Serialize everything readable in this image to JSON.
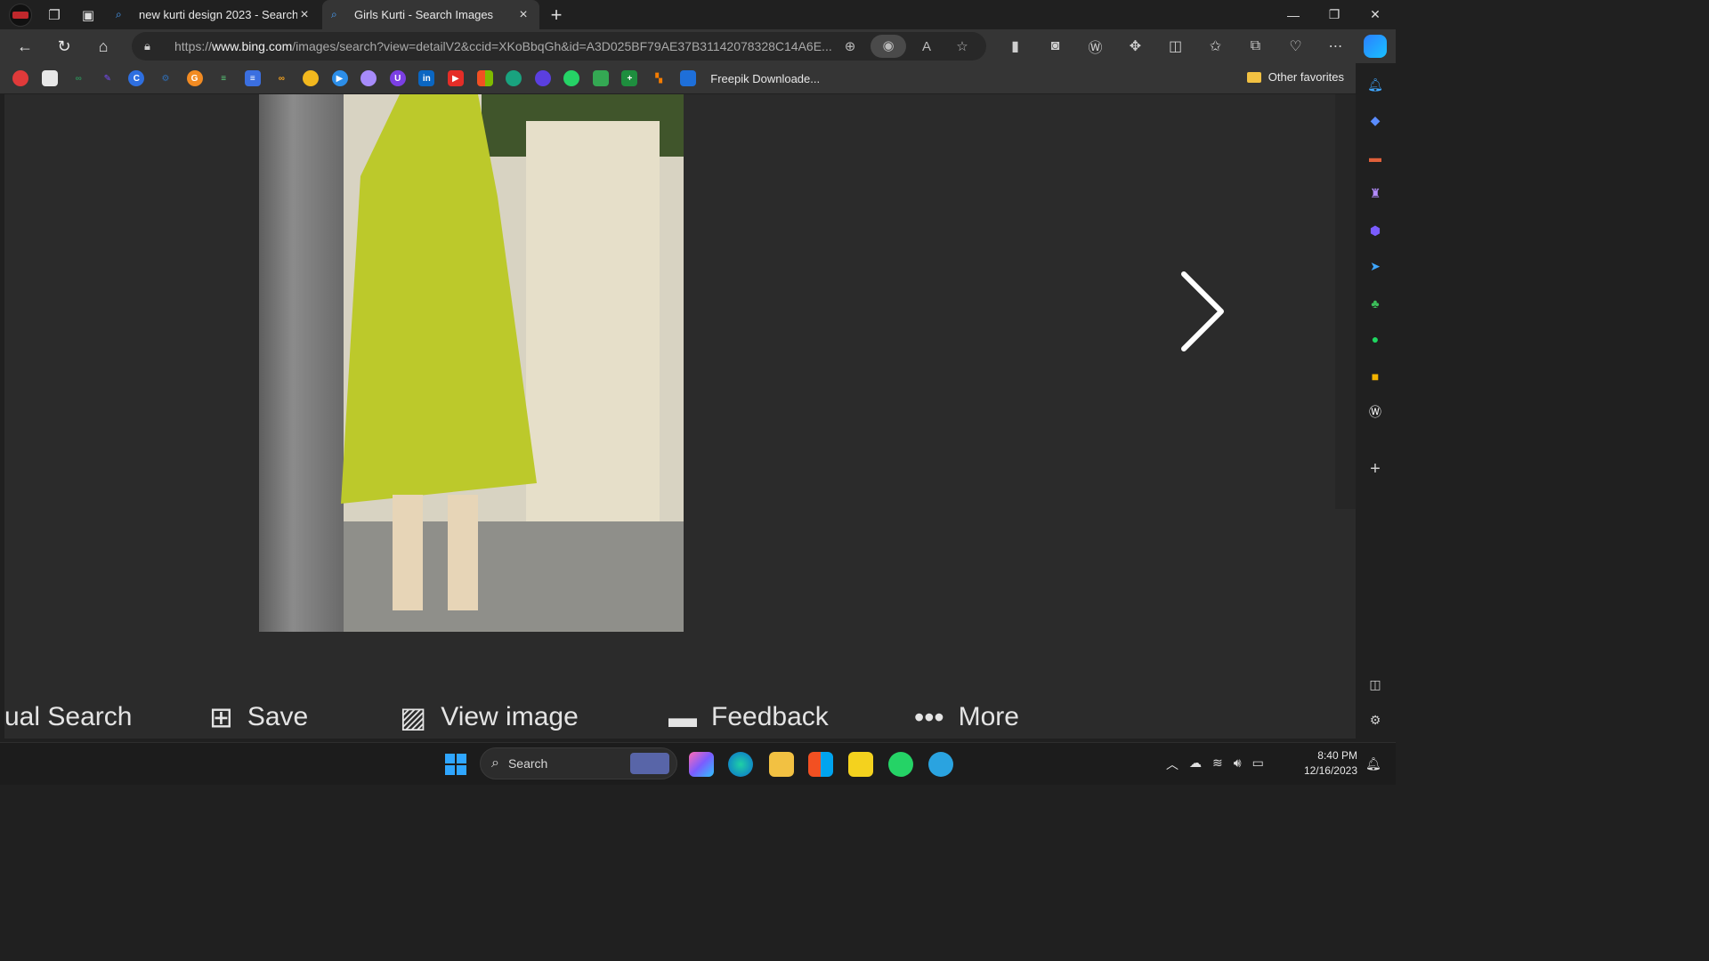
{
  "browser": {
    "tabs": [
      {
        "title": "new kurti design 2023 - Search",
        "active": false
      },
      {
        "title": "Girls Kurti - Search Images",
        "active": true
      }
    ],
    "url_prefix": "https://",
    "url_domain": "www.bing.com",
    "url_rest": "/images/search?view=detailV2&ccid=XKoBbqGh&id=A3D025BF79AE37B31142078328C14A6E...",
    "favorites_label": "Freepik Downloade...",
    "other_favorites": "Other favorites"
  },
  "viewer": {
    "actions": [
      {
        "label": "ual Search",
        "icon": "visual-search-icon"
      },
      {
        "label": "Save",
        "icon": "save-icon"
      },
      {
        "label": "View image",
        "icon": "view-image-icon"
      },
      {
        "label": "Feedback",
        "icon": "feedback-icon"
      },
      {
        "label": "More",
        "icon": "more-icon"
      }
    ]
  },
  "taskbar": {
    "search_label": "Search",
    "time": "8:40 PM",
    "date": "12/16/2023"
  },
  "colors": {
    "accent": "#2fa6ff",
    "kurti": "#bcc92b"
  }
}
